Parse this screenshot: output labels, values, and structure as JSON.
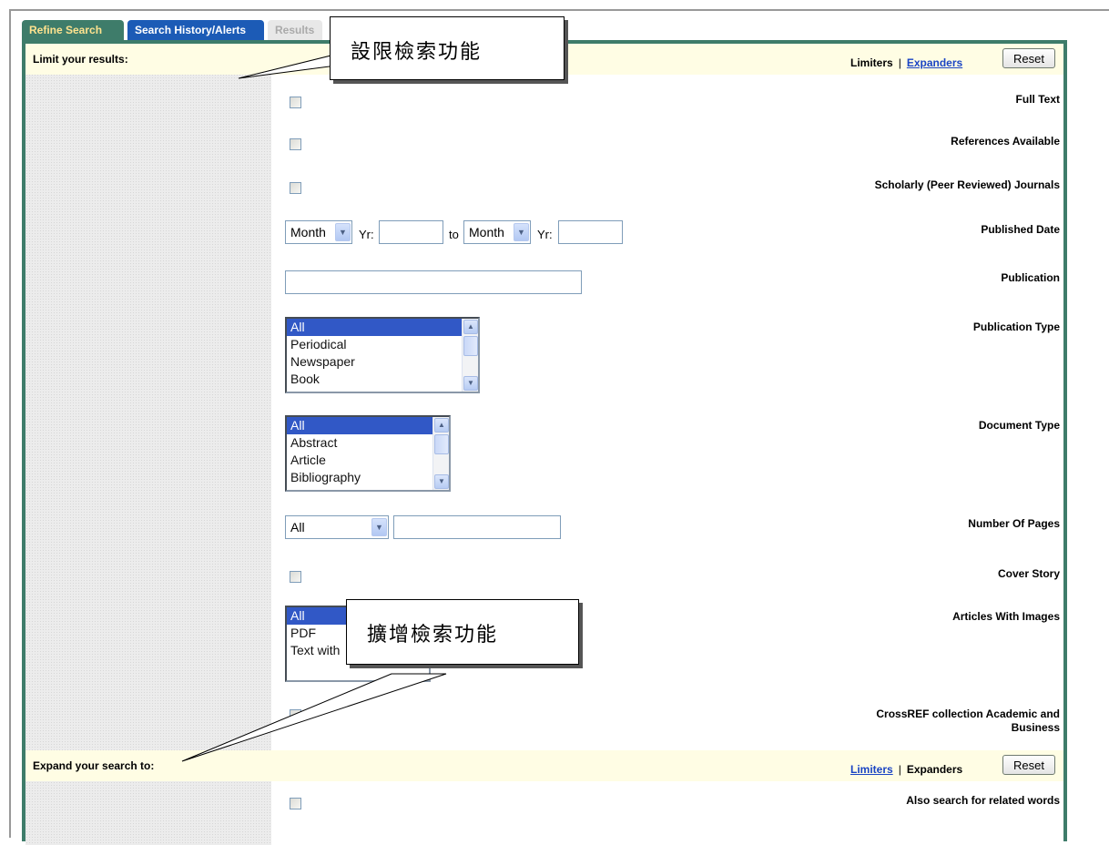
{
  "tabs": {
    "refine": "Refine Search",
    "history": "Search History/Alerts",
    "results": "Results"
  },
  "limit_bar": {
    "title": "Limit your results:",
    "limiters": "Limiters",
    "expanders": "Expanders",
    "reset": "Reset"
  },
  "limiters": {
    "full_text": "Full Text",
    "references": "References Available",
    "scholarly": "Scholarly (Peer Reviewed) Journals",
    "published_date": "Published Date",
    "month_from": "Month",
    "yr_label": "Yr:",
    "to_label": "to",
    "month_to": "Month",
    "publication": "Publication",
    "publication_type": "Publication Type",
    "publication_type_options": [
      "All",
      "Periodical",
      "Newspaper",
      "Book"
    ],
    "document_type": "Document Type",
    "document_type_options": [
      "All",
      "Abstract",
      "Article",
      "Bibliography"
    ],
    "number_of_pages": "Number Of Pages",
    "pages_select": "All",
    "cover_story": "Cover Story",
    "articles_with_images": "Articles With Images",
    "images_options": [
      "All",
      "PDF",
      "Text with"
    ],
    "crossref": "CrossREF collection Academic and Business"
  },
  "expand_bar": {
    "title": "Expand your search to:",
    "limiters": "Limiters",
    "expanders": "Expanders",
    "reset": "Reset"
  },
  "expanders": {
    "related_words": "Also search for related words"
  },
  "callouts": {
    "limit": "設限檢索功能",
    "expand": "擴增檢索功能"
  },
  "icons": {
    "dropdown": "chevron-down-icon",
    "scroll_up": "arrow-up-icon",
    "scroll_down": "arrow-down-icon"
  },
  "colors": {
    "tab_active": "#3e7c6a",
    "tab_history": "#1c5bb6",
    "panel_border": "#3e7c6a",
    "bar_bg": "#fffde4",
    "link": "#1a44c4",
    "selection": "#3158c6"
  }
}
